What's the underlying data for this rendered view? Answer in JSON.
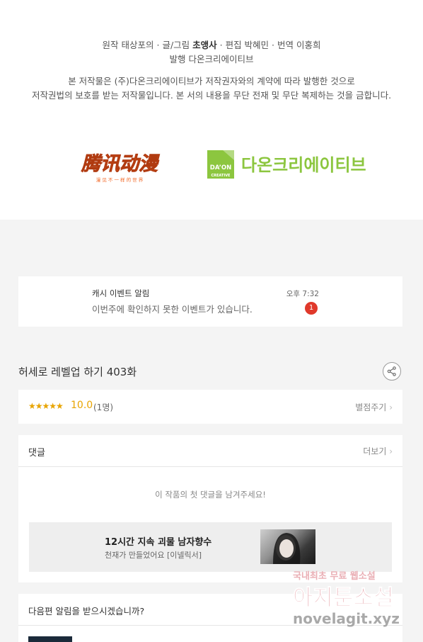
{
  "credits": {
    "line1_prefix": "원작 태상포의 · 글/그림 ",
    "line1_bold": "초앵사",
    "line1_suffix": " · 편집 박혜민 · 번역 이홍희",
    "line2": "발행 다온크리에이티브"
  },
  "copyright": {
    "line1": "본 저작물은 (주)다온크리에이티브가 저작권자와의 계약에 따라 발행한 것으로",
    "line2": "저작권법의 보호를 받는 저작물입니다. 본 서의 내용을 무단 전재 및 무단 복제하는 것을 금합니다."
  },
  "logos": {
    "tencent_main": "腾讯动漫",
    "tencent_sub": "漫 见 不 一 样 的 世 界",
    "daon_mark_top": "DA’ON",
    "daon_mark_bottom": "CREATIVE",
    "daon_text": "다온크리에이티브",
    "daon_color": "#8cc63f",
    "tencent_color": "#f26522"
  },
  "notice": {
    "title": "캐시 이벤트 알림",
    "text": "이번주에 확인하지 못한 이벤트가 있습니다.",
    "time": "오후 7:32",
    "badge": "1"
  },
  "episode": {
    "title": "허세로 레벨업 하기 403화"
  },
  "rating": {
    "stars": "★★★★★",
    "score": "10.0",
    "count": "(1명)",
    "rate_label": "별점주기"
  },
  "comments": {
    "title": "댓글",
    "more_label": "더보기",
    "empty_text": "이 작품의 첫 댓글을 남겨주세요!"
  },
  "ad": {
    "title": "12시간 지속 괴물 남자향수",
    "subtitle": "천재가 만들었어요 [이넬릭서]"
  },
  "next_alert": {
    "title": "다음편 알림을 받으시겠습니까?"
  },
  "watermark": {
    "line1": "국내최초 무료 웹소설",
    "line2": "아지툰소설",
    "line3": "novelagit.xyz"
  }
}
